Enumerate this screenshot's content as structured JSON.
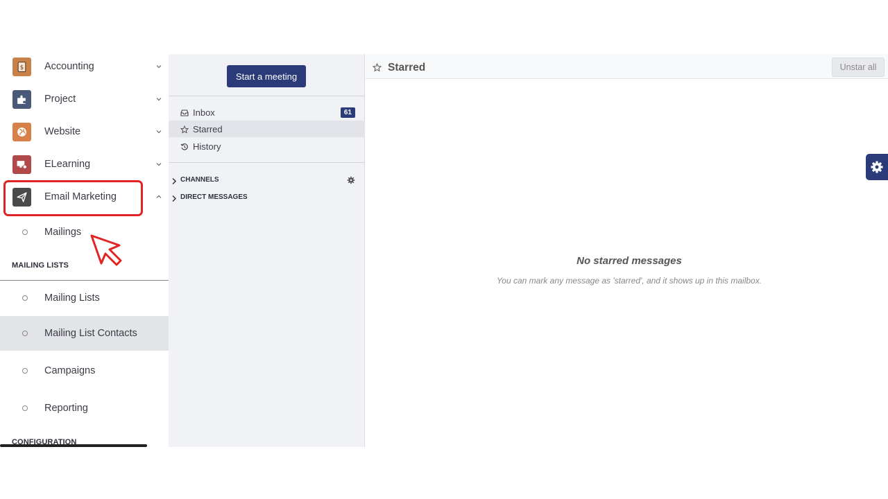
{
  "sidebar": {
    "apps": [
      {
        "label": "Accounting",
        "icon": "accounting-icon",
        "color": "#c9814a",
        "expanded": false
      },
      {
        "label": "Project",
        "icon": "puzzle-icon",
        "color": "#4a5a78",
        "expanded": false
      },
      {
        "label": "Website",
        "icon": "globe-icon",
        "color": "#d8804a",
        "expanded": false
      },
      {
        "label": "ELearning",
        "icon": "elearning-icon",
        "color": "#b04a4a",
        "expanded": false
      },
      {
        "label": "Email Marketing",
        "icon": "paper-plane-icon",
        "color": "#4a4a4a",
        "expanded": true
      }
    ],
    "submenu": {
      "mailings": "Mailings"
    },
    "mailing_lists_section": {
      "title": "MAILING LISTS",
      "items": [
        "Mailing Lists",
        "Mailing List Contacts",
        "Campaigns",
        "Reporting"
      ],
      "active_index": 1
    },
    "configuration_section": {
      "title": "CONFIGURATION"
    }
  },
  "discuss": {
    "start_meeting_label": "Start a meeting",
    "mailboxes": [
      {
        "label": "Inbox",
        "icon": "inbox-icon",
        "badge": "61"
      },
      {
        "label": "Starred",
        "icon": "star-icon",
        "active": true
      },
      {
        "label": "History",
        "icon": "history-icon"
      }
    ],
    "categories": [
      {
        "label": "CHANNELS",
        "has_settings": true
      },
      {
        "label": "DIRECT MESSAGES",
        "has_settings": false
      }
    ]
  },
  "main": {
    "title": "Starred",
    "unstar_label": "Unstar all",
    "empty_title": "No starred messages",
    "empty_text": "You can mark any message as 'starred', and it shows up in this mailbox."
  },
  "colors": {
    "brand": "#2b3a78",
    "highlight": "#e02424"
  }
}
